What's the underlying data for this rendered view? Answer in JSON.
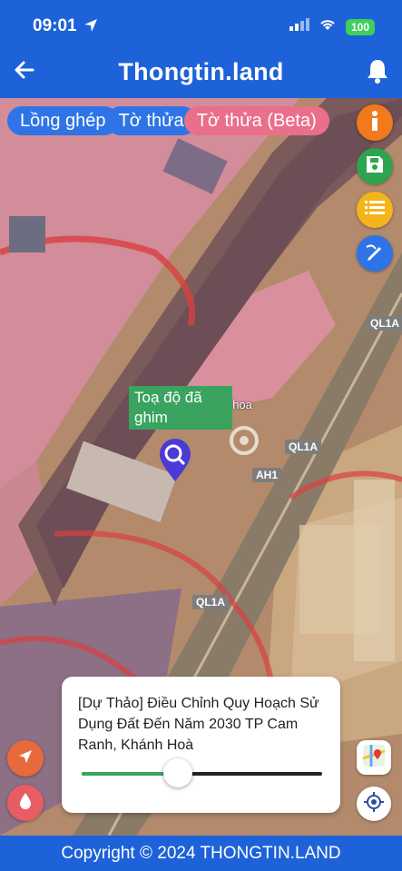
{
  "status": {
    "time": "09:01",
    "battery": "100"
  },
  "header": {
    "title": "Thongtin.land"
  },
  "tabs": [
    "Lồng ghép",
    "Tờ thửa",
    "Tờ thửa (Beta)"
  ],
  "map": {
    "pin_label": "Toạ độ đã ghim",
    "road_labels": [
      "QL1A",
      "QL1A",
      "AH1",
      "QL1A"
    ],
    "place_label": "minh... nhsx tm ... hoa"
  },
  "panel": {
    "text": "[Dự Thảo] Điều Chỉnh Quy Hoạch Sử Dụng Đất Đến Năm 2030 TP Cam Ranh, Khánh Hoà",
    "opacity_level": 0.4
  },
  "footer": {
    "copyright": "Copyright © 2024 THONGTIN.LAND"
  },
  "colors": {
    "header": "#1d62d8",
    "info": "#f07a1c",
    "save": "#2ea44f",
    "list": "#f4b51b",
    "draw": "#2f74e6",
    "planning": "#e85c64",
    "chip_beta": "#ea6f8b"
  },
  "icons": [
    "back-arrow-icon",
    "bell-icon",
    "info-icon",
    "save-icon",
    "list-icon",
    "draw-icon",
    "navigate-icon",
    "water-drop-icon",
    "map-layers-icon",
    "locate-icon",
    "pin-icon"
  ]
}
